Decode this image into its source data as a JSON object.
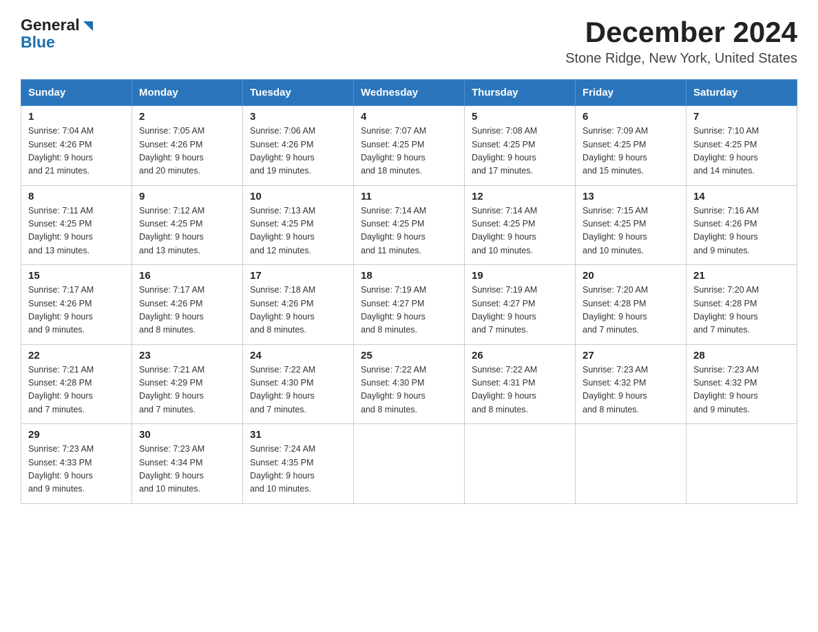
{
  "header": {
    "logo_general": "General",
    "logo_blue": "Blue",
    "title": "December 2024",
    "subtitle": "Stone Ridge, New York, United States"
  },
  "days_of_week": [
    "Sunday",
    "Monday",
    "Tuesday",
    "Wednesday",
    "Thursday",
    "Friday",
    "Saturday"
  ],
  "weeks": [
    [
      {
        "day": "1",
        "sunrise": "7:04 AM",
        "sunset": "4:26 PM",
        "daylight": "9 hours and 21 minutes."
      },
      {
        "day": "2",
        "sunrise": "7:05 AM",
        "sunset": "4:26 PM",
        "daylight": "9 hours and 20 minutes."
      },
      {
        "day": "3",
        "sunrise": "7:06 AM",
        "sunset": "4:26 PM",
        "daylight": "9 hours and 19 minutes."
      },
      {
        "day": "4",
        "sunrise": "7:07 AM",
        "sunset": "4:25 PM",
        "daylight": "9 hours and 18 minutes."
      },
      {
        "day": "5",
        "sunrise": "7:08 AM",
        "sunset": "4:25 PM",
        "daylight": "9 hours and 17 minutes."
      },
      {
        "day": "6",
        "sunrise": "7:09 AM",
        "sunset": "4:25 PM",
        "daylight": "9 hours and 15 minutes."
      },
      {
        "day": "7",
        "sunrise": "7:10 AM",
        "sunset": "4:25 PM",
        "daylight": "9 hours and 14 minutes."
      }
    ],
    [
      {
        "day": "8",
        "sunrise": "7:11 AM",
        "sunset": "4:25 PM",
        "daylight": "9 hours and 13 minutes."
      },
      {
        "day": "9",
        "sunrise": "7:12 AM",
        "sunset": "4:25 PM",
        "daylight": "9 hours and 13 minutes."
      },
      {
        "day": "10",
        "sunrise": "7:13 AM",
        "sunset": "4:25 PM",
        "daylight": "9 hours and 12 minutes."
      },
      {
        "day": "11",
        "sunrise": "7:14 AM",
        "sunset": "4:25 PM",
        "daylight": "9 hours and 11 minutes."
      },
      {
        "day": "12",
        "sunrise": "7:14 AM",
        "sunset": "4:25 PM",
        "daylight": "9 hours and 10 minutes."
      },
      {
        "day": "13",
        "sunrise": "7:15 AM",
        "sunset": "4:25 PM",
        "daylight": "9 hours and 10 minutes."
      },
      {
        "day": "14",
        "sunrise": "7:16 AM",
        "sunset": "4:26 PM",
        "daylight": "9 hours and 9 minutes."
      }
    ],
    [
      {
        "day": "15",
        "sunrise": "7:17 AM",
        "sunset": "4:26 PM",
        "daylight": "9 hours and 9 minutes."
      },
      {
        "day": "16",
        "sunrise": "7:17 AM",
        "sunset": "4:26 PM",
        "daylight": "9 hours and 8 minutes."
      },
      {
        "day": "17",
        "sunrise": "7:18 AM",
        "sunset": "4:26 PM",
        "daylight": "9 hours and 8 minutes."
      },
      {
        "day": "18",
        "sunrise": "7:19 AM",
        "sunset": "4:27 PM",
        "daylight": "9 hours and 8 minutes."
      },
      {
        "day": "19",
        "sunrise": "7:19 AM",
        "sunset": "4:27 PM",
        "daylight": "9 hours and 7 minutes."
      },
      {
        "day": "20",
        "sunrise": "7:20 AM",
        "sunset": "4:28 PM",
        "daylight": "9 hours and 7 minutes."
      },
      {
        "day": "21",
        "sunrise": "7:20 AM",
        "sunset": "4:28 PM",
        "daylight": "9 hours and 7 minutes."
      }
    ],
    [
      {
        "day": "22",
        "sunrise": "7:21 AM",
        "sunset": "4:28 PM",
        "daylight": "9 hours and 7 minutes."
      },
      {
        "day": "23",
        "sunrise": "7:21 AM",
        "sunset": "4:29 PM",
        "daylight": "9 hours and 7 minutes."
      },
      {
        "day": "24",
        "sunrise": "7:22 AM",
        "sunset": "4:30 PM",
        "daylight": "9 hours and 7 minutes."
      },
      {
        "day": "25",
        "sunrise": "7:22 AM",
        "sunset": "4:30 PM",
        "daylight": "9 hours and 8 minutes."
      },
      {
        "day": "26",
        "sunrise": "7:22 AM",
        "sunset": "4:31 PM",
        "daylight": "9 hours and 8 minutes."
      },
      {
        "day": "27",
        "sunrise": "7:23 AM",
        "sunset": "4:32 PM",
        "daylight": "9 hours and 8 minutes."
      },
      {
        "day": "28",
        "sunrise": "7:23 AM",
        "sunset": "4:32 PM",
        "daylight": "9 hours and 9 minutes."
      }
    ],
    [
      {
        "day": "29",
        "sunrise": "7:23 AM",
        "sunset": "4:33 PM",
        "daylight": "9 hours and 9 minutes."
      },
      {
        "day": "30",
        "sunrise": "7:23 AM",
        "sunset": "4:34 PM",
        "daylight": "9 hours and 10 minutes."
      },
      {
        "day": "31",
        "sunrise": "7:24 AM",
        "sunset": "4:35 PM",
        "daylight": "9 hours and 10 minutes."
      },
      null,
      null,
      null,
      null
    ]
  ],
  "labels": {
    "sunrise": "Sunrise:",
    "sunset": "Sunset:",
    "daylight": "Daylight:"
  }
}
